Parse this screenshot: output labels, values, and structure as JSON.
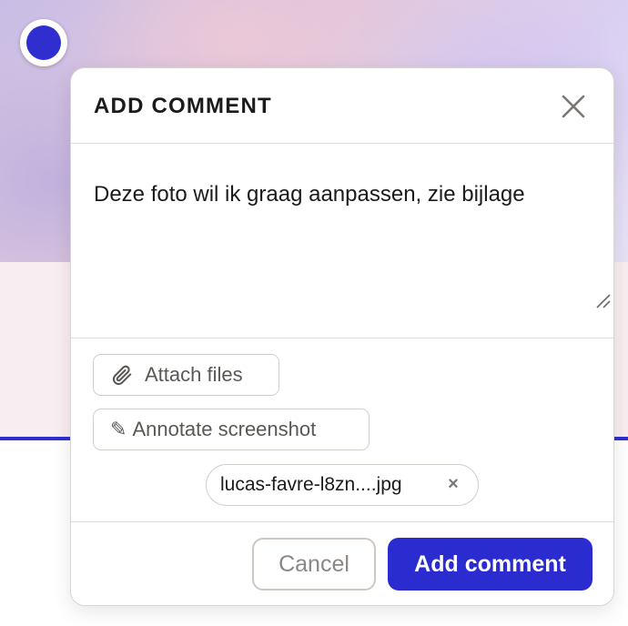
{
  "dialog": {
    "title": "ADD COMMENT",
    "close_icon": "close-icon",
    "comment_text": "Deze foto wil ik graag aanpassen, zie bijlage",
    "attach_label": "Attach files",
    "attach_icon": "paperclip-icon",
    "annotate_label": "Annotate screenshot",
    "annotate_icon": "pencil-icon",
    "annotate_glyph": "✎",
    "attachment": {
      "filename": "lucas-favre-l8zn....jpg",
      "remove_glyph": "×"
    },
    "cancel_label": "Cancel",
    "submit_label": "Add comment"
  },
  "colors": {
    "accent": "#2a2ccf",
    "pin": "#2f2fcf"
  }
}
